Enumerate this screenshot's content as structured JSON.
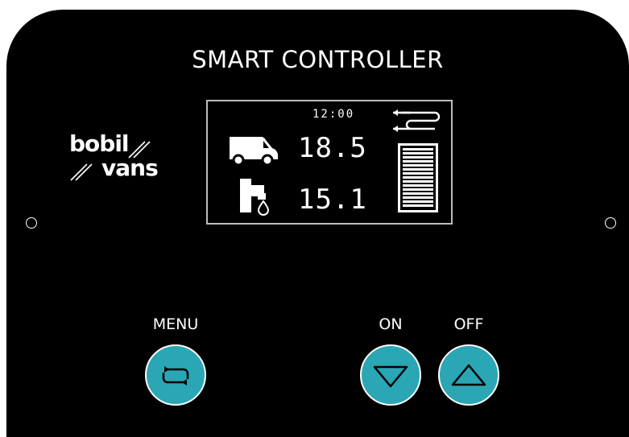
{
  "device": {
    "title": "SMART CONTROLLER",
    "brand": {
      "line1": "bobil",
      "line2": "vans"
    }
  },
  "display": {
    "clock": "12:00",
    "van_value": "18.5",
    "water_value": "15.1",
    "icons": [
      "van-icon",
      "faucet-icon",
      "heater-icon",
      "battery-level-icon"
    ]
  },
  "buttons": {
    "menu_label": "MENU",
    "on_label": "ON",
    "off_label": "OFF"
  },
  "colors": {
    "panel": "#000000",
    "button": "#2aa6b4",
    "text": "#ffffff",
    "screen_border": "#bdbdbd"
  }
}
